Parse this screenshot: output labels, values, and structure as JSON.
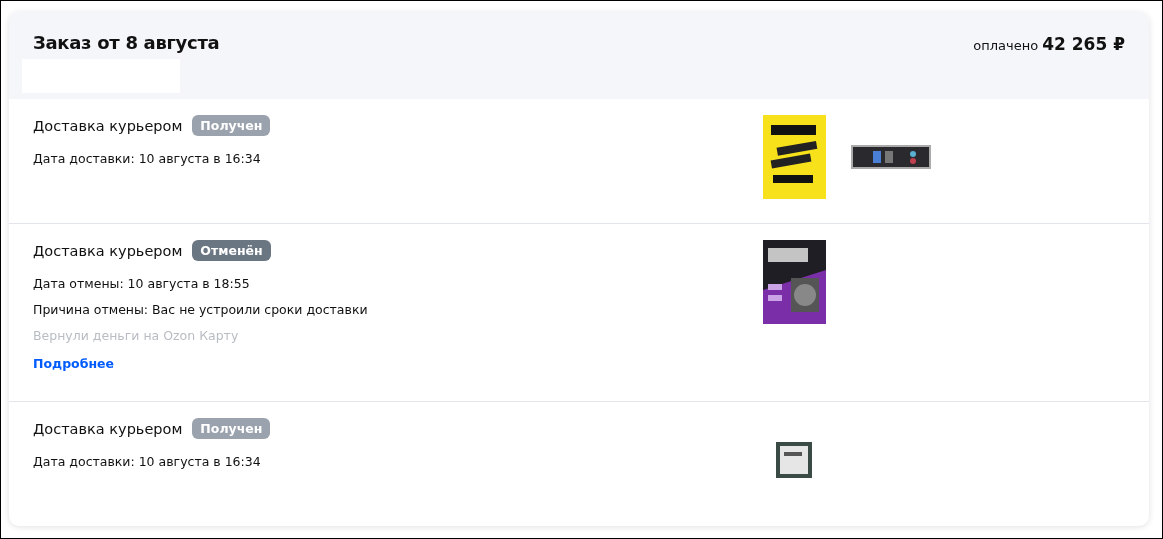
{
  "order": {
    "title": "Заказ от 8 августа",
    "paid_label": "оплачено",
    "paid_amount": "42 265 ₽"
  },
  "shipments": [
    {
      "title": "Доставка курьером",
      "status": {
        "label": "Получен",
        "kind": "received"
      },
      "lines": [
        {
          "text": "Дата доставки: 10 августа в 16:34",
          "kind": "normal"
        }
      ],
      "products": [
        {
          "kind": "picture"
        },
        {
          "kind": "picture"
        }
      ]
    },
    {
      "title": "Доставка курьером",
      "status": {
        "label": "Отменён",
        "kind": "cancelled"
      },
      "lines": [
        {
          "text": "Дата отмены: 10 августа в 18:55",
          "kind": "normal"
        },
        {
          "text": "Причина отмены: Вас не устроили сроки доставки",
          "kind": "normal"
        },
        {
          "text": "Вернули деньги на Ozon Карту",
          "kind": "muted"
        },
        {
          "text": "Подробнее",
          "kind": "link"
        }
      ],
      "products": [
        {
          "kind": "picture"
        }
      ]
    },
    {
      "title": "Доставка курьером",
      "status": {
        "label": "Получен",
        "kind": "received"
      },
      "lines": [
        {
          "text": "Дата доставки: 10 августа в 16:34",
          "kind": "normal"
        }
      ],
      "products": [
        {
          "kind": "picture"
        }
      ]
    }
  ]
}
